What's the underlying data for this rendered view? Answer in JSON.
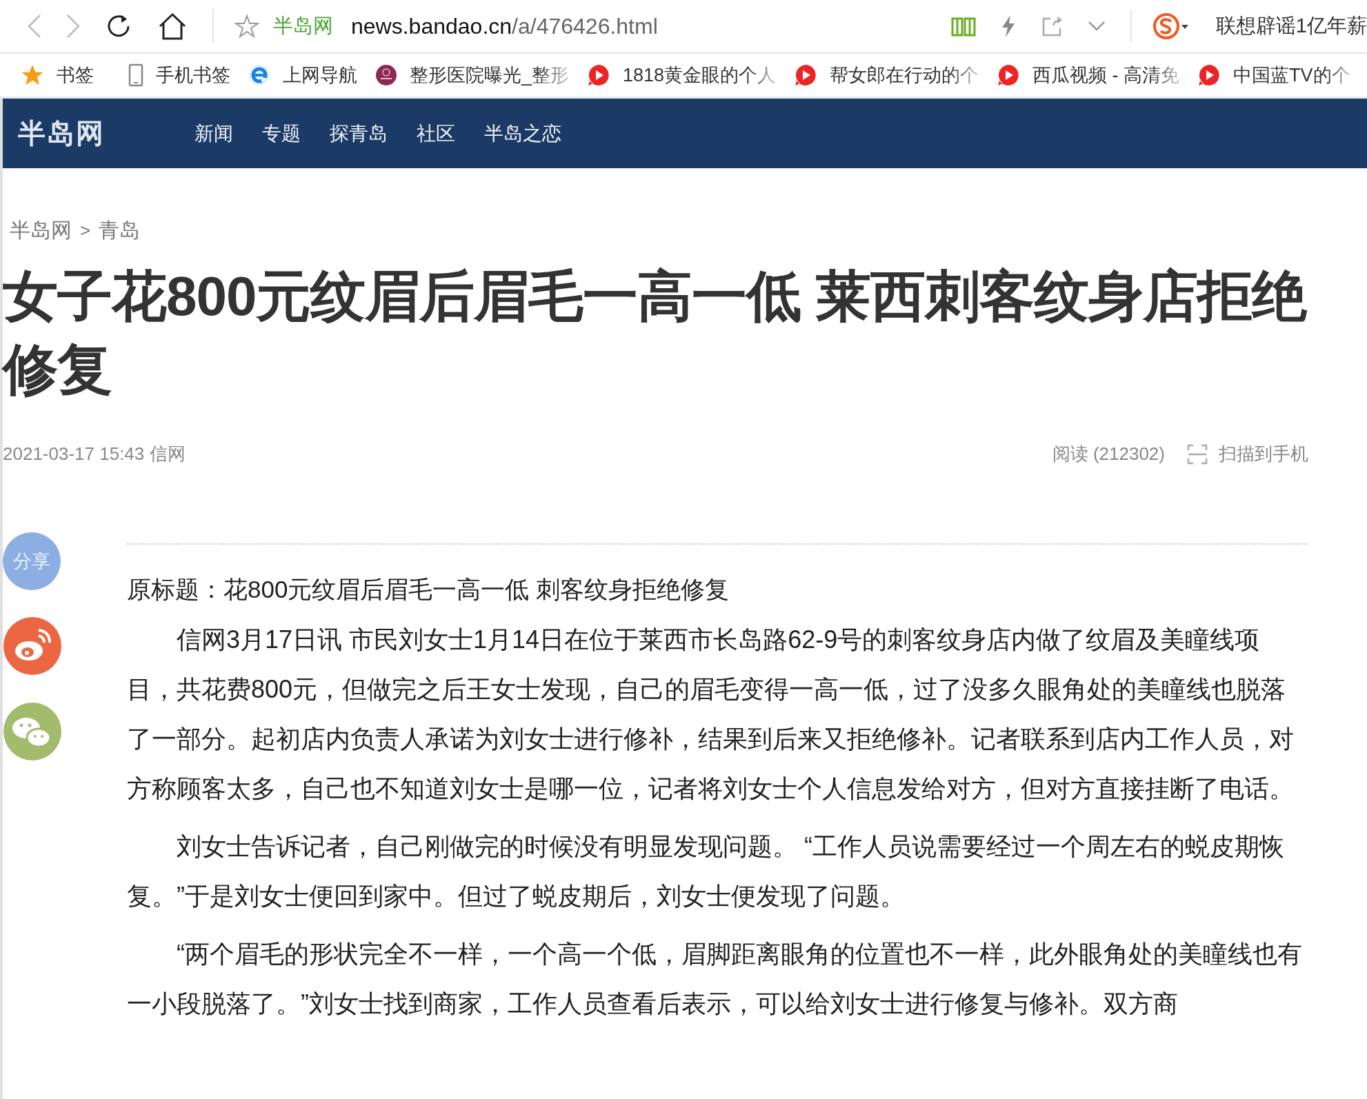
{
  "browser": {
    "site_name": "半岛网",
    "url_host": "news.bandao.cn",
    "url_path": "/a/476426.html",
    "search_hint": "联想辟谣1亿年薪"
  },
  "bookmarks": [
    {
      "label": "书签",
      "kind": "star"
    },
    {
      "label": "手机书签",
      "kind": "phone"
    },
    {
      "label": "上网导航",
      "kind": "ie"
    },
    {
      "label": "整形医院曝光_整形",
      "kind": "badge"
    },
    {
      "label": "1818黄金眼的个人",
      "kind": "video"
    },
    {
      "label": "帮女郎在行动的个",
      "kind": "video"
    },
    {
      "label": "西瓜视频 - 高清免",
      "kind": "video"
    },
    {
      "label": "中国蓝TV的个",
      "kind": "video"
    }
  ],
  "site": {
    "logo": "半岛网",
    "nav": [
      "新闻",
      "专题",
      "探青岛",
      "社区",
      "半岛之恋"
    ]
  },
  "breadcrumb": {
    "items": [
      "半岛网",
      "青岛"
    ],
    "separator": ">"
  },
  "article": {
    "title": "女子花800元纹眉后眉毛一高一低 莱西刺客纹身店拒绝修复",
    "date": "2021-03-17 15:43",
    "source": "信网",
    "reads": "阅读 (212302)",
    "scan": "扫描到手机",
    "original_title": "原标题：花800元纹眉后眉毛一高一低 刺客纹身拒绝修复",
    "paragraphs": [
      "信网3月17日讯 市民刘女士1月14日在位于莱西市长岛路62-9号的刺客纹身店内做了纹眉及美瞳线项目，共花费800元，但做完之后王女士发现，自己的眉毛变得一高一低，过了没多久眼角处的美瞳线也脱落了一部分。起初店内负责人承诺为刘女士进行修补，结果到后来又拒绝修补。记者联系到店内工作人员，对方称顾客太多，自己也不知道刘女士是哪一位，记者将刘女士个人信息发给对方，但对方直接挂断了电话。",
      "刘女士告诉记者，自己刚做完的时候没有明显发现问题。 “工作人员说需要经过一个周左右的蜕皮期恢复。”于是刘女士便回到家中。但过了蜕皮期后，刘女士便发现了问题。",
      "“两个眉毛的形状完全不一样，一个高一个低，眉脚距离眼角的位置也不一样，此外眼角处的美瞳线也有一小段脱落了。”刘女士找到商家，工作人员查看后表示，可以给刘女士进行修复与修补。双方商"
    ]
  },
  "share": {
    "label": "分享"
  }
}
